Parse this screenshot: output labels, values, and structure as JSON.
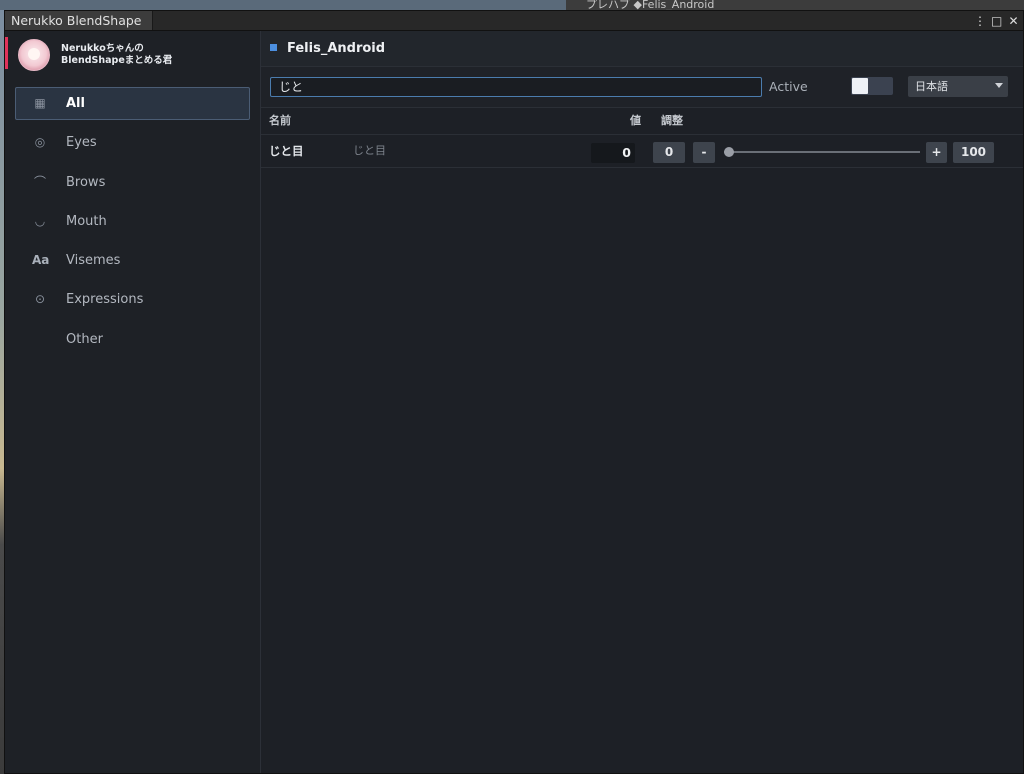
{
  "background": {
    "right_tab_text": "プレハブ ◆Felis_Android"
  },
  "window": {
    "tab_title": "Nerukko BlendShape",
    "controls": {
      "menu": "⋮",
      "maximize": "□",
      "close": "✕"
    }
  },
  "sidebar": {
    "brand": {
      "line1": "Nerukkoちゃんの",
      "line2": "BlendShapeまとめる君"
    },
    "items": [
      {
        "label": "All",
        "icon": "grid-icon",
        "glyph": "▦",
        "active": true
      },
      {
        "label": "Eyes",
        "icon": "eye-icon",
        "glyph": "◎",
        "active": false
      },
      {
        "label": "Brows",
        "icon": "brow-icon",
        "glyph": "⌒",
        "active": false
      },
      {
        "label": "Mouth",
        "icon": "mouth-icon",
        "glyph": "◡",
        "active": false
      },
      {
        "label": "Visemes",
        "icon": "text-aa-icon",
        "glyph": "Aa",
        "active": false
      },
      {
        "label": "Expressions",
        "icon": "expression-icon",
        "glyph": "⊙",
        "active": false
      },
      {
        "label": "Other",
        "icon": "",
        "glyph": "",
        "active": false
      }
    ]
  },
  "header": {
    "title": "Felis_Android"
  },
  "toolbar": {
    "search_value": "じと",
    "active_label": "Active",
    "active_on": false,
    "language": "日本語"
  },
  "table": {
    "columns": {
      "name": "名前",
      "value": "値",
      "adjust": "調整"
    },
    "rows": [
      {
        "name": "じと目",
        "original_name": "じと目",
        "value": "0",
        "btn_zero": "0",
        "btn_minus": "-",
        "btn_plus": "+",
        "btn_max": "100",
        "slider_fraction": 0
      }
    ]
  },
  "colors": {
    "accent": "#4c8fe0",
    "brand_accent": "#e0325a",
    "bg": "#1d2026"
  }
}
